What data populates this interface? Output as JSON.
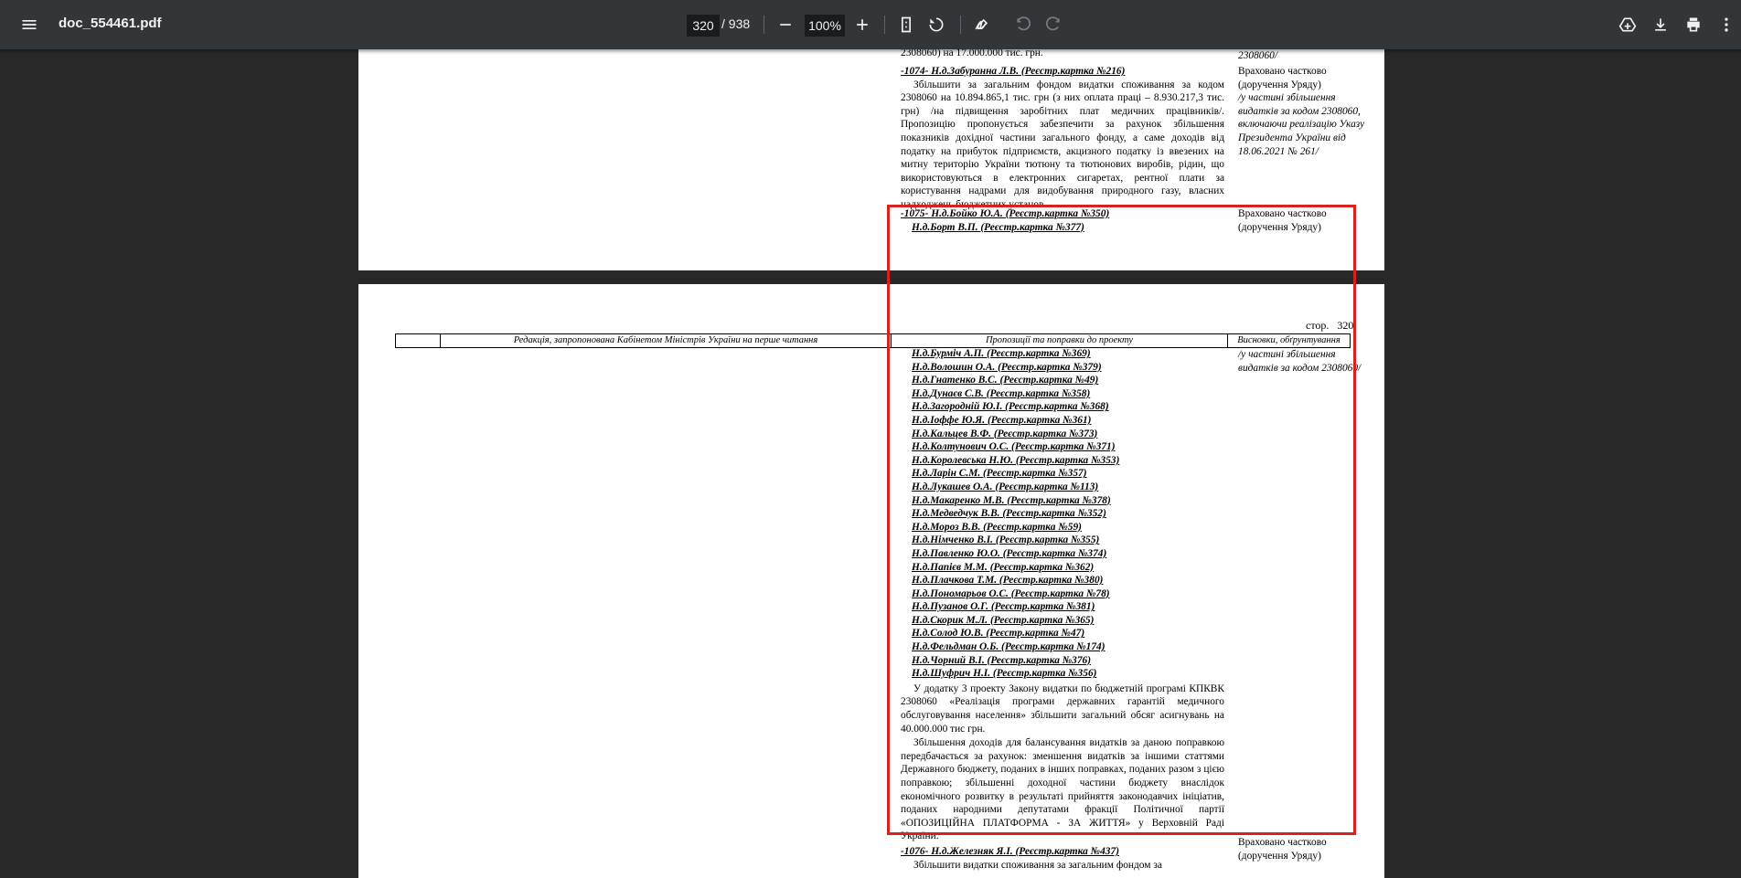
{
  "toolbar": {
    "title": "doc_554461.pdf",
    "page_current": "320",
    "page_total": "/ 938",
    "zoom": "100%"
  },
  "page1": {
    "top_fragment": "2308060) на 17.000.000 тис. грн.",
    "top_fragment_verdict": "2308060/",
    "entry1074": {
      "head": "-1074- Н.д.Забуранна Л.В. (Реєстр.картка №216)",
      "body": "Збільшити за загальним фондом видатки споживання за кодом 2308060 на 10.894.865,1 тис. грн (з них оплата праці – 8.930.217,3 тис. грн) /на підвищення заробітних плат медичних працівників/. Пропозицію пропонується забезпечити за рахунок збільшення показників дохідної частини загального фонду, а саме доходів від податку на прибуток підприємств, акцизного податку із ввезених на митну територію України тютюну та тютюнових виробів, рідин, що використовуються в електронних сигаретах, рентної плати за користування надрами для видобування природного газу, власних надходжень бюджетних установ.",
      "verdict_line1": "Враховано частково",
      "verdict_line2": "(доручення Уряду)",
      "verdict_italic": "/у частині збільшення видатків за кодом 2308060, включаючи реалізацію Указу Президента України від 18.06.2021 № 261/"
    },
    "entry1075": {
      "head": "-1075- Н.д.Бойко Ю.А. (Реєстр.картка №350)",
      "name": "Н.д.Борт В.П. (Реєстр.картка №377)",
      "verdict_line1": "Враховано частково",
      "verdict_line2": "(доручення Уряду)"
    }
  },
  "page2": {
    "page_label": "стор.",
    "page_number": "320",
    "header_col1": "Редакція, запропонована Кабінетом Міністрів України на перше читання",
    "header_col2": "Пропозиції та поправки до проекту",
    "header_col3": "Висновки, обґрунтування",
    "verdict_continued": "/у частині збільшення видатків за кодом 2308060/",
    "names": [
      "Н.д.Бурміч А.П. (Реєстр.картка №369)",
      "Н.д.Волошин О.А. (Реєстр.картка №379)",
      "Н.д.Гнатенко В.С. (Реєстр.картка №49)",
      "Н.д.Дунаєв С.В. (Реєстр.картка №358)",
      "Н.д.Загородній Ю.І. (Реєстр.картка №368)",
      "Н.д.Іоффе Ю.Я. (Реєстр.картка №361)",
      "Н.д.Кальцев В.Ф. (Реєстр.картка №373)",
      "Н.д.Колтунович О.С. (Реєстр.картка №371)",
      "Н.д.Королевська Н.Ю. (Реєстр.картка №353)",
      "Н.д.Ларін С.М. (Реєстр.картка №357)",
      "Н.д.Лукашев О.А. (Реєстр.картка №113)",
      "Н.д.Макаренко М.В. (Реєстр.картка №378)",
      "Н.д.Медведчук В.В. (Реєстр.картка №352)",
      "Н.д.Мороз В.В. (Реєстр.картка №59)",
      "Н.д.Німченко В.І. (Реєстр.картка №355)",
      "Н.д.Павленко Ю.О. (Реєстр.картка №374)",
      "Н.д.Папієв М.М. (Реєстр.картка №362)",
      "Н.д.Плачкова Т.М. (Реєстр.картка №380)",
      "Н.д.Пономарьов О.С. (Реєстр.картка №78)",
      "Н.д.Пузанов О.Г. (Реєстр.картка №381)",
      "Н.д.Скорик М.Л. (Реєстр.картка №365)",
      "Н.д.Солод Ю.В. (Реєстр.картка №47)",
      "Н.д.Фельдман О.Б. (Реєстр.картка №174)",
      "Н.д.Чорний В.І. (Реєстр.картка №376)",
      "Н.д.Шуфрич Н.І. (Реєстр.картка №356)"
    ],
    "paragraph1": "У додатку 3 проекту Закону видатки по бюджетній програмі КПКВК 2308060 «Реалізація програми державних гарантій медичного обслуговування населення» збільшити загальний обсяг асигнувань на 40.000.000 тис грн.",
    "paragraph2": "Збільшення доходів для балансування видатків за даною поправкою передбачається за рахунок: зменшення видатків за іншими статтями Державного бюджету, поданих в інших поправках, поданих разом з цією поправкою; збільшенні доходної частини бюджету внаслідок економічного розвитку в результаті прийняття законодавчих ініціатив, поданих народними депутатами фракції Політичної партії «ОПОЗИЦІЙНА ПЛАТФОРМА - ЗА ЖИТТЯ» у Верховній Раді України.",
    "entry1076": {
      "head": "-1076- Н.д.Железняк Я.І. (Реєстр.картка №437)",
      "body": "Збільшити видатки споживання за загальним фондом за",
      "verdict_line1": "Враховано частково",
      "verdict_line2": "(доручення Уряду)"
    }
  },
  "colors": {
    "toolbar_bg": "#323639",
    "viewer_bg": "#282828",
    "highlight": "#d9211f"
  },
  "icons": [
    "menu-icon",
    "fit-page-icon",
    "rotate-icon",
    "annotate-icon",
    "undo-icon",
    "redo-icon",
    "drive-icon",
    "download-icon",
    "print-icon",
    "more-vert-icon"
  ]
}
